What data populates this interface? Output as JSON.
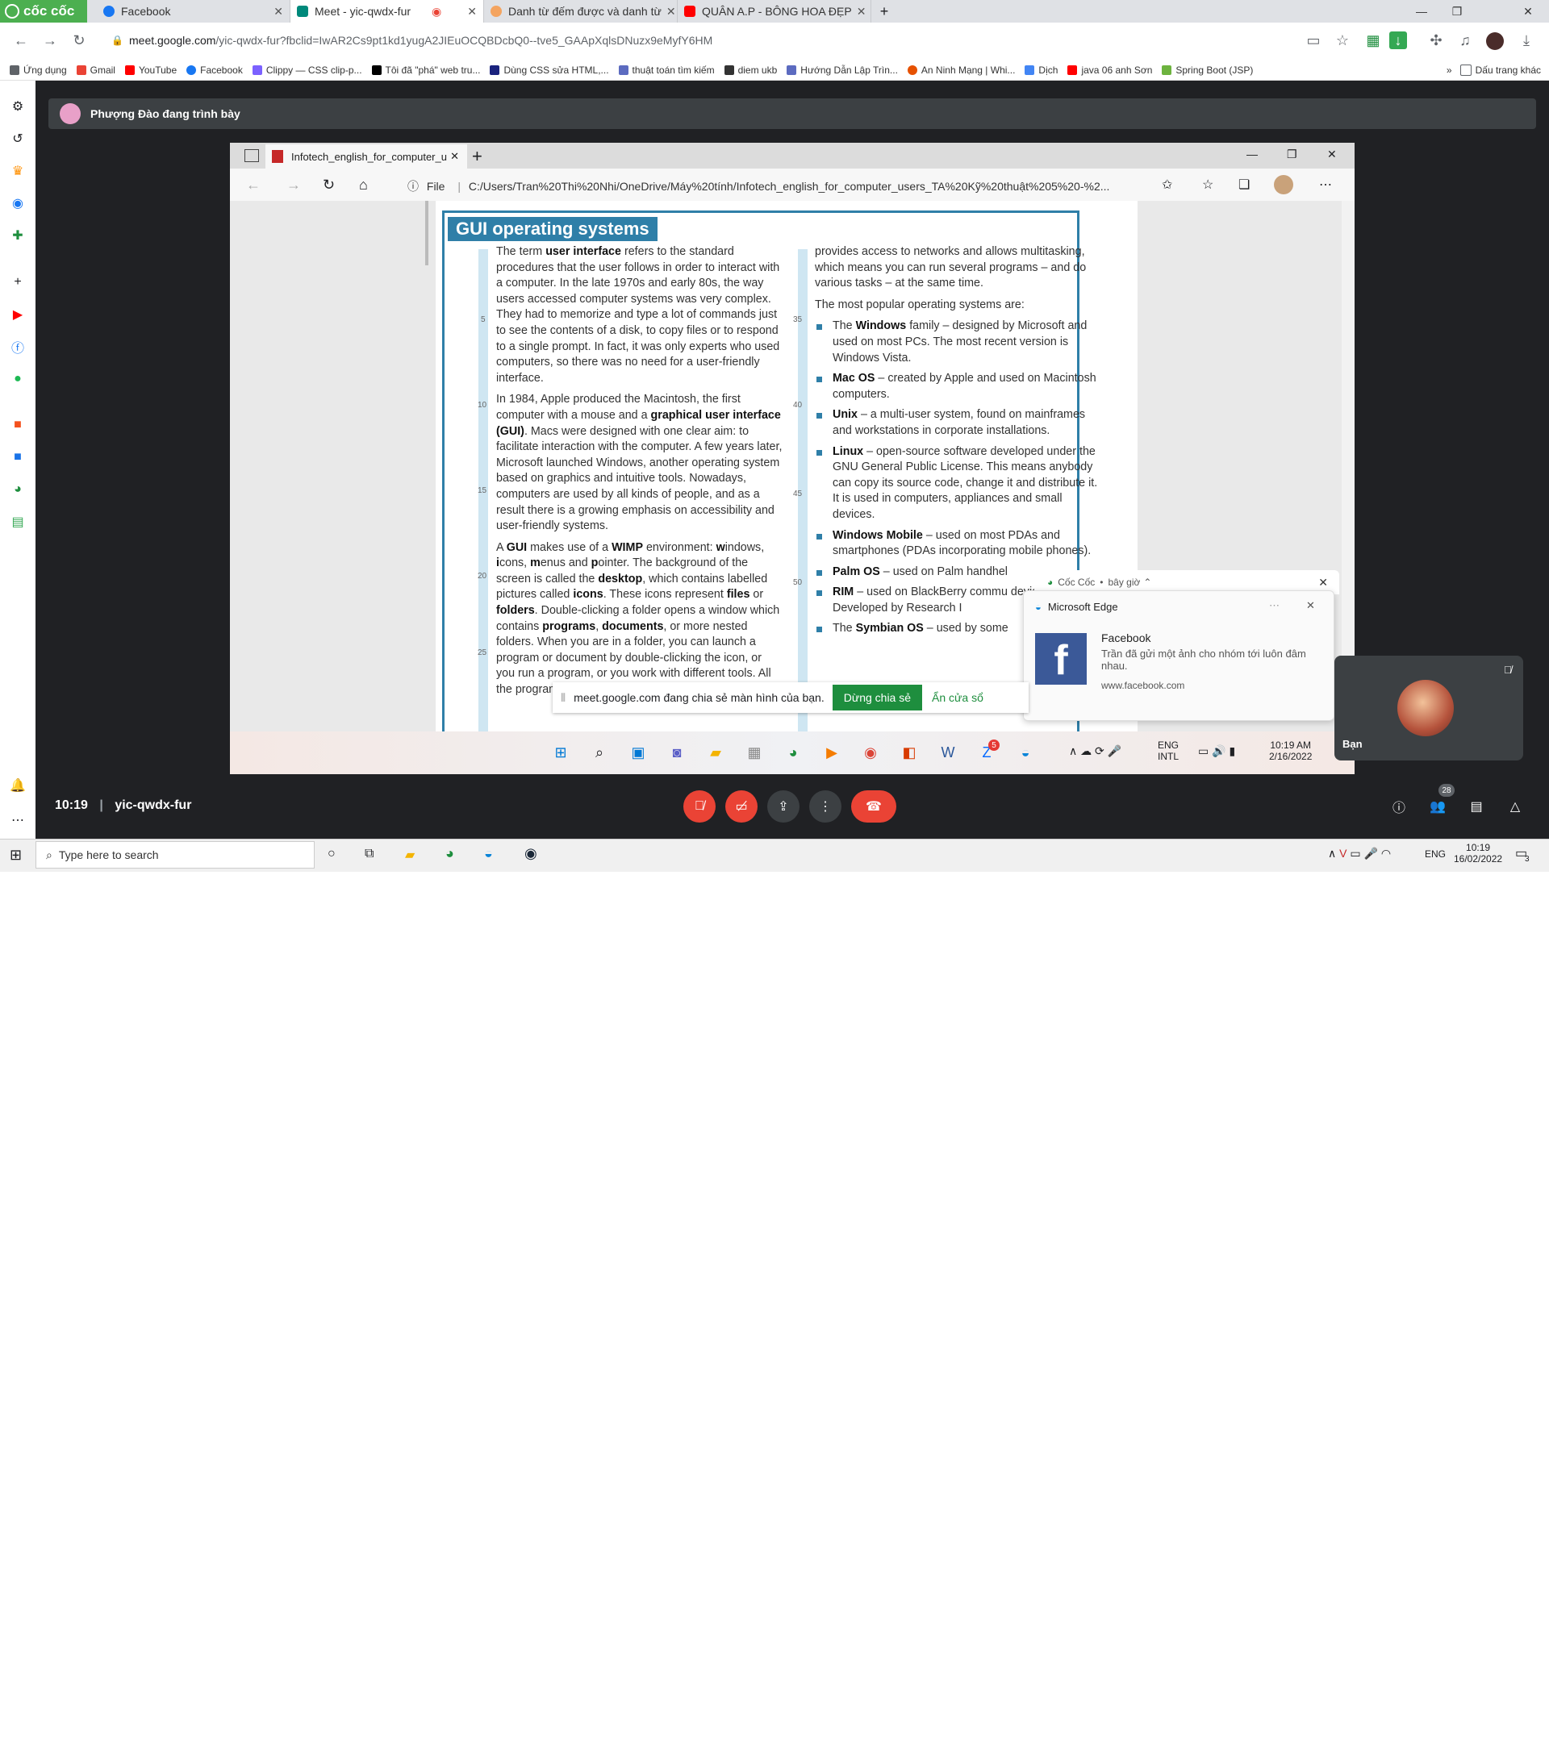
{
  "browser": {
    "brand_label": "cốc cốc",
    "tabs": [
      {
        "label": "Facebook",
        "color": "#1877f2"
      },
      {
        "label": "Meet - yic-qwdx-fur",
        "color": "#00897b"
      },
      {
        "label": "Danh từ đếm được và danh từ",
        "color": "#f4a460"
      },
      {
        "label": "QUÂN A.P - BÔNG HOA ĐẸP",
        "color": "#ff0000"
      }
    ],
    "url_host": "meet.google.com",
    "url_rest": "/yic-qwdx-fur?fbclid=IwAR2Cs9pt1kd1yugA2JIEuOCQBDcbQ0--tve5_GAApXqlsDNuzx9eMyfY6HM",
    "bookmarks": [
      {
        "label": "Ứng dụng",
        "color": "#5f6368"
      },
      {
        "label": "Gmail",
        "color": "#ea4335"
      },
      {
        "label": "YouTube",
        "color": "#ff0000"
      },
      {
        "label": "Facebook",
        "color": "#1877f2"
      },
      {
        "label": "Clippy — CSS clip-p...",
        "color": "#7b61ff"
      },
      {
        "label": "Tôi đã \"phá\" web tru...",
        "color": "#000000"
      },
      {
        "label": "Dùng CSS sửa HTML,...",
        "color": "#1a237e"
      },
      {
        "label": "thuật toán tìm kiếm",
        "color": "#5c6bc0"
      },
      {
        "label": "diem ukb",
        "color": "#333333"
      },
      {
        "label": "Hướng Dẫn Lập Trìn...",
        "color": "#5c6bc0"
      },
      {
        "label": "An Ninh Mạng | Whi...",
        "color": "#e65100"
      },
      {
        "label": "Dịch",
        "color": "#4285f4"
      },
      {
        "label": "java 06 anh Sơn",
        "color": "#ff0000"
      },
      {
        "label": "Spring Boot (JSP)",
        "color": "#6db33f"
      }
    ],
    "other_bookmarks": "Dấu trang khác"
  },
  "meet": {
    "presenter_text": "Phượng Đào đang trình bày",
    "time": "10:19",
    "meeting_code": "yic-qwdx-fur",
    "participants_count": "28",
    "you_label": "Bạn"
  },
  "shared_screen": {
    "edge_tab_label": "Infotech_english_for_computer_u",
    "edge_file_label": "File",
    "edge_url": "C:/Users/Tran%20Thi%20Nhi/OneDrive/Máy%20tính/Infotech_english_for_computer_users_TA%20Kỹ%20thuật%205%20-%2...",
    "doc_title": "GUI operating systems",
    "col1": [
      "The term <b>user interface</b> refers to the standard procedures that the user follows in order to interact with a computer. In the late 1970s and early 80s, the way users accessed computer systems was very complex. They had to memorize and type a lot of commands just to see the contents of a disk, to copy files or to respond to a single prompt. In fact, it was only experts who used computers, so there was no need for a user-friendly interface.",
      "In 1984, Apple produced the Macintosh, the first computer with a mouse and a <b>graphical user interface (GUI)</b>. Macs were designed with one clear aim: to facilitate interaction with the computer. A few years later, Microsoft launched Windows, another operating system based on graphics and intuitive tools. Nowadays, computers are used by all kinds of people, and as a result there is a growing emphasis on accessibility and user-friendly systems.",
      "A <b>GUI</b> makes use of a <b>WIMP</b> environment: <b>w</b>indows, <b>i</b>cons, <b>m</b>enus and <b>p</b>ointer. The background of the screen is called the <b>desktop</b>, which contains labelled pictures called <b>icons</b>. These icons represent <b>files</b> or <b>folders</b>. Double-clicking a folder opens a window which contains <b>programs</b>, <b>documents</b>, or more nested folders. When you are in a folder, you can launch a program or document by double-clicking the icon, or you run a program, or you work with different tools. All the programs have a"
    ],
    "col2_intro": "provides access to networks and allows multitasking, which means you can run several programs – and do various tasks – at the same time.",
    "col2_lead": "The most popular operating systems are:",
    "col2_items": [
      "The <b>Windows</b> family – designed by Microsoft and used on most PCs. The most recent version is Windows Vista.",
      "<b>Mac OS</b> – created by Apple and used on Macintosh computers.",
      "<b>Unix</b> – a multi-user system, found on mainframes and workstations in corporate installations.",
      "<b>Linux</b> – open-source software developed under the GNU General Public License. This means anybody can copy its source code, change it and distribute it. It is used in computers, appliances and small devices.",
      "<b>Windows Mobile</b> – used on most PDAs and smartphones (PDAs incorporating mobile phones).",
      "<b>Palm OS</b> – used on Palm handhel",
      "<b>RIM</b> – used on BlackBerry commu devices. Developed by Research I",
      "The <b>Symbian OS</b> – used by some"
    ],
    "line_numbers_left": [
      "5",
      "10",
      "15",
      "20",
      "25"
    ],
    "line_numbers_right": [
      "35",
      "40",
      "45",
      "50"
    ],
    "edge_clock_time": "10:19 AM",
    "edge_clock_date": "2/16/2022",
    "edge_lang_1": "ENG",
    "edge_lang_2": "INTL",
    "zalo_badge": "5"
  },
  "notifications": {
    "coccoc_source": "Cốc Cốc",
    "coccoc_time": "bây giờ",
    "edge_app": "Microsoft Edge",
    "fb_title": "Facebook",
    "fb_body": "Trần đã gửi một ảnh cho nhóm tới luôn đâm nhau.",
    "fb_site": "www.facebook.com"
  },
  "share_banner": {
    "text": "meet.google.com đang chia sẻ màn hình của bạn.",
    "stop_label": "Dừng chia sẻ",
    "hide_label": "Ẩn cửa sổ"
  },
  "windows": {
    "search_placeholder": "Type here to search",
    "lang": "ENG",
    "clock_time": "10:19",
    "clock_date": "16/02/2022",
    "notif_count": "3"
  },
  "colors": {
    "meet_bg": "#202124",
    "end_call": "#ea4335",
    "accent_blue": "#2f7fa8",
    "share_green": "#1e8e3e"
  }
}
